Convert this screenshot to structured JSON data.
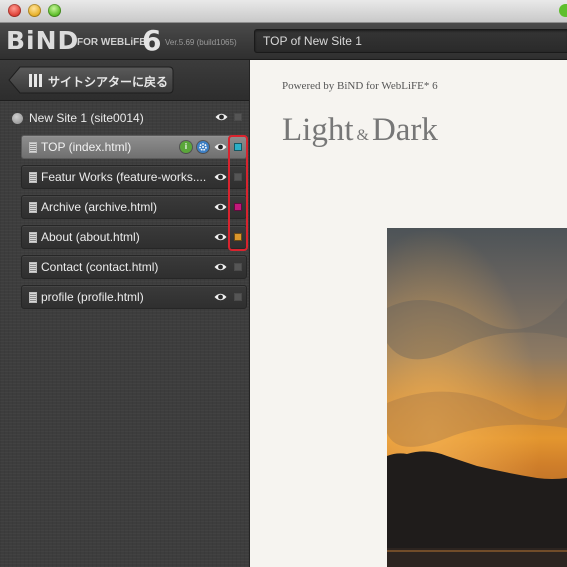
{
  "window": {
    "controls": [
      "close",
      "minimize",
      "zoom"
    ]
  },
  "header": {
    "logo_main": "BiND",
    "logo_sub": "FOR WEBLiFE*",
    "logo_number": "6",
    "version": "Ver.5.69 (build1065)",
    "page_title": "TOP of New Site 1"
  },
  "sidebar": {
    "back_label": "サイトシアターに戻る",
    "site_label": "New Site 1 (site0014)",
    "pages": [
      {
        "label": "TOP (index.html)",
        "selected": true,
        "color": "#2bb0c7"
      },
      {
        "label": "Featur Works (feature-works....",
        "selected": false,
        "color": "#555555"
      },
      {
        "label": "Archive (archive.html)",
        "selected": false,
        "color": "#c2187a"
      },
      {
        "label": "About (about.html)",
        "selected": false,
        "color": "#d9962c"
      },
      {
        "label": "Contact (contact.html)",
        "selected": false,
        "color": "#555555"
      },
      {
        "label": "profile (profile.html)",
        "selected": false,
        "color": "#555555"
      }
    ],
    "top_badges": {
      "info": "i",
      "settings": "gear"
    }
  },
  "content": {
    "powered_by": "Powered by BiND for WebLiFE* 6",
    "brand_left": "Light",
    "brand_amp": "&",
    "brand_right": "Dark"
  },
  "colors": {
    "highlight": "#d9232e",
    "info_badge": "#5aa63a",
    "settings_badge": "#3d7fc4"
  }
}
